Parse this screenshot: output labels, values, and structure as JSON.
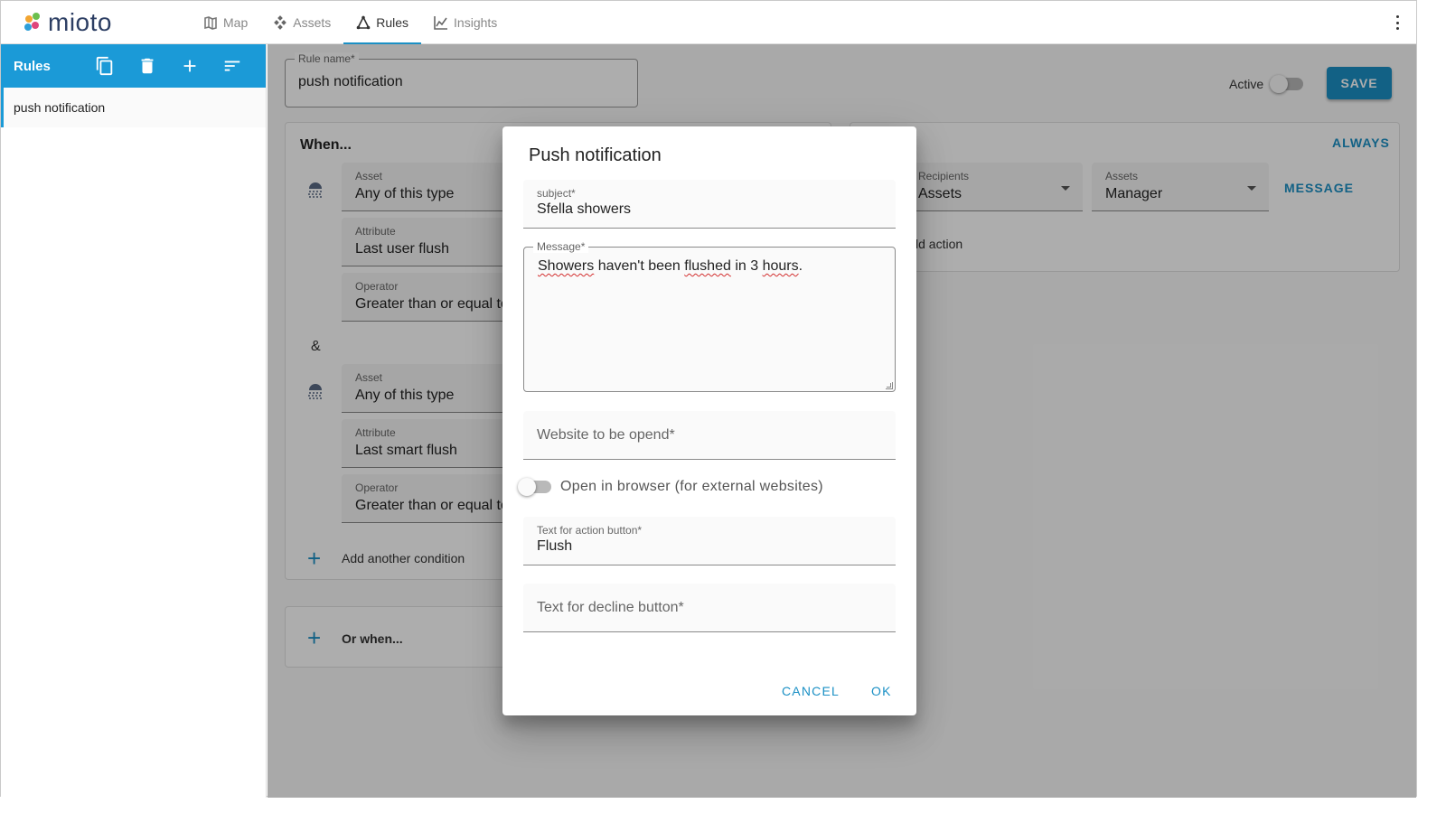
{
  "app": {
    "logo_text": "mioto",
    "colors": {
      "accent": "#1b90c5",
      "sidebar_header": "#1b9ad7"
    }
  },
  "nav": {
    "items": [
      {
        "label": "Map",
        "icon": "map-icon"
      },
      {
        "label": "Assets",
        "icon": "assets-icon"
      },
      {
        "label": "Rules",
        "icon": "rules-icon",
        "active": true
      },
      {
        "label": "Insights",
        "icon": "insights-icon"
      }
    ]
  },
  "sidebar": {
    "title": "Rules",
    "tools": [
      "copy-icon",
      "delete-icon",
      "add-icon",
      "sort-icon"
    ],
    "items": [
      {
        "label": "push notification"
      }
    ]
  },
  "rule": {
    "name_label": "Rule name*",
    "name_value": "push notification",
    "active_label": "Active",
    "save_label": "SAVE"
  },
  "when": {
    "title": "When...",
    "group1": {
      "asset_label": "Asset",
      "asset_value": "Any of this type",
      "attribute_label": "Attribute",
      "attribute_value": "Last user flush",
      "operator_label": "Operator",
      "operator_value": "Greater than or equal to"
    },
    "amp": "&",
    "group2": {
      "asset_label": "Asset",
      "asset_value": "Any of this type",
      "attribute_label": "Attribute",
      "attribute_value": "Last smart flush",
      "operator_label": "Operator",
      "operator_value": "Greater than or equal to"
    },
    "add_condition": "Add another condition",
    "or_when": "Or when..."
  },
  "then": {
    "always": "ALWAYS",
    "recipients_label": "Recipients",
    "recipients_value": "Assets",
    "assets_label": "Assets",
    "assets_value": "Manager",
    "message_link": "MESSAGE",
    "add_action": "Add action"
  },
  "dialog": {
    "title": "Push notification",
    "subject_label": "subject*",
    "subject_value": "Sfella showers",
    "message_label": "Message*",
    "message_words": [
      "Showers",
      " haven't been ",
      "flushed",
      " in 3 ",
      "hours",
      "."
    ],
    "website_placeholder": "Website to be opend*",
    "open_browser_label": "Open in browser (for external websites)",
    "action_label": "Text for action button*",
    "action_value": "Flush",
    "decline_placeholder": "Text for decline button*",
    "cancel": "CANCEL",
    "ok": "OK"
  }
}
